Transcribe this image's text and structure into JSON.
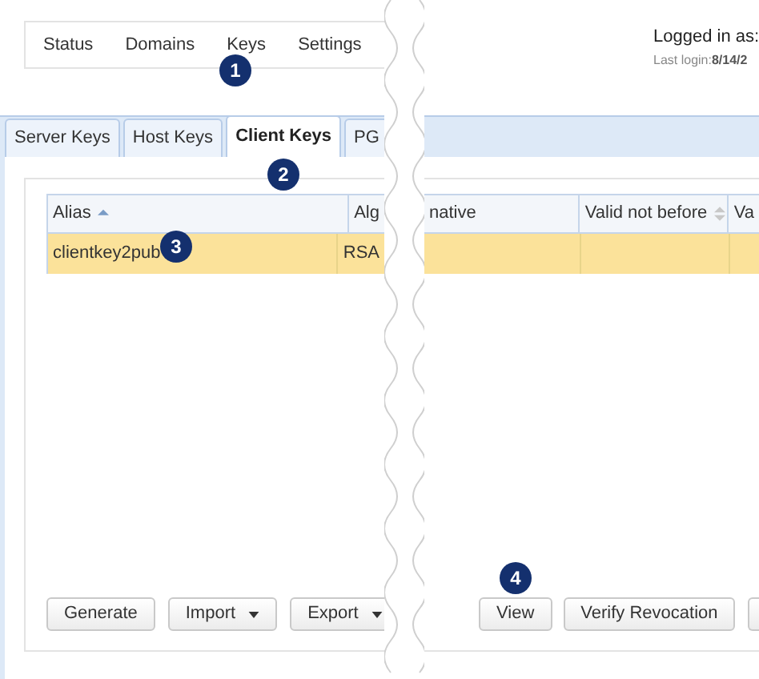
{
  "nav": [
    {
      "label": "Status"
    },
    {
      "label": "Domains"
    },
    {
      "label": "Keys"
    },
    {
      "label": "Settings"
    }
  ],
  "user": {
    "logged_in_label": "Logged in as:",
    "last_login_label": "Last login:",
    "last_login_value": "8/14/2"
  },
  "tabs": [
    {
      "label": "Server Keys",
      "selected": false
    },
    {
      "label": "Host Keys",
      "selected": false
    },
    {
      "label": "Client Keys",
      "selected": true
    },
    {
      "label": "PG",
      "selected": false
    }
  ],
  "table": {
    "columns_left": [
      {
        "label": "Alias",
        "sorted_ascending": true
      },
      {
        "label": "Alg"
      }
    ],
    "columns_right": [
      {
        "label": "native"
      },
      {
        "label": "Valid not before",
        "sortable": true
      },
      {
        "label": "Va"
      }
    ],
    "rows": [
      {
        "alias": "clientkey2pub",
        "algorithm": "RSA",
        "selected": true
      }
    ]
  },
  "buttons_left": [
    {
      "label": "Generate",
      "dropdown": false
    },
    {
      "label": "Import",
      "dropdown": true
    },
    {
      "label": "Export",
      "dropdown": true
    }
  ],
  "buttons_right": [
    {
      "label": "View",
      "dropdown": false
    },
    {
      "label": "Verify Revocation",
      "dropdown": false
    }
  ],
  "cut_off_button": true,
  "callouts": [
    "1",
    "2",
    "3",
    "4"
  ]
}
